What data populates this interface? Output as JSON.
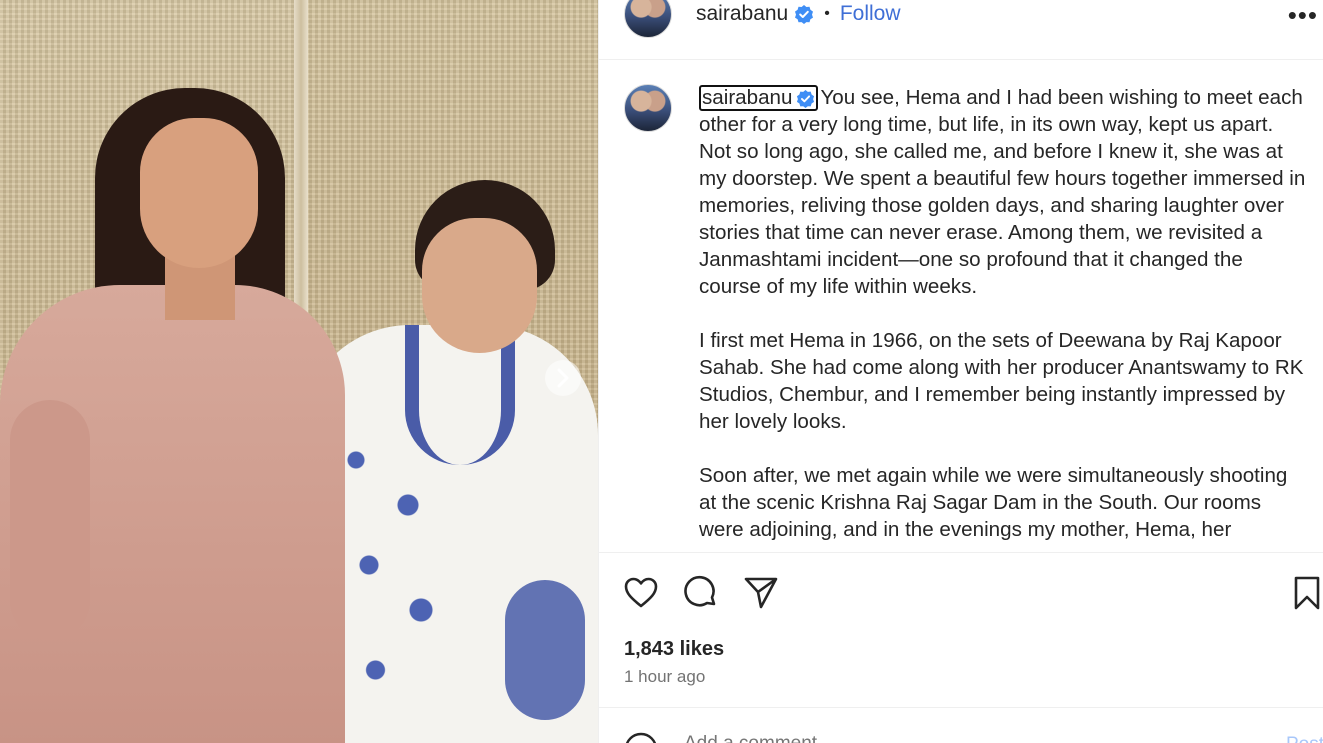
{
  "post": {
    "username": "sairabanu",
    "follow_label": "Follow",
    "separator": "•",
    "more_glyph": "•••"
  },
  "caption": {
    "username": "sairabanu",
    "text": "You see, Hema and I had been wishing to meet each other for a very long time, but life, in its own way, kept us apart. Not so long ago, she called me, and before I knew it, she was at my doorstep. We spent a beautiful few hours together immersed in memories, reliving those golden days, and sharing laughter over stories that time can never erase. Among them, we revisited a Janmashtami incident—one so profound that it changed the course of my life within weeks.\n\nI first met Hema in 1966, on the sets of Deewana by Raj Kapoor Sahab. She had come along with her producer Anantswamy to RK Studios, Chembur, and I remember being instantly impressed by her lovely looks.\n\nSoon after, we met again while we were simultaneously shooting at the scenic Krishna Raj Sagar Dam in the South. Our rooms were adjoining, and in the evenings my mother, Hema, her"
  },
  "engagement": {
    "likes": "1,843 likes",
    "time": "1 hour ago"
  },
  "comment": {
    "placeholder": "Add a comment…",
    "post_label": "Post"
  },
  "icons": {
    "verified": "verified-badge-icon",
    "like": "heart-icon",
    "comment": "comment-icon",
    "share": "send-icon",
    "save": "bookmark-icon",
    "next": "chevron-right-icon",
    "emoji": "emoji-icon"
  },
  "colors": {
    "verified": "#3f8ef5",
    "follow": "#3f6fd6",
    "text": "#262626",
    "muted": "#737373"
  }
}
